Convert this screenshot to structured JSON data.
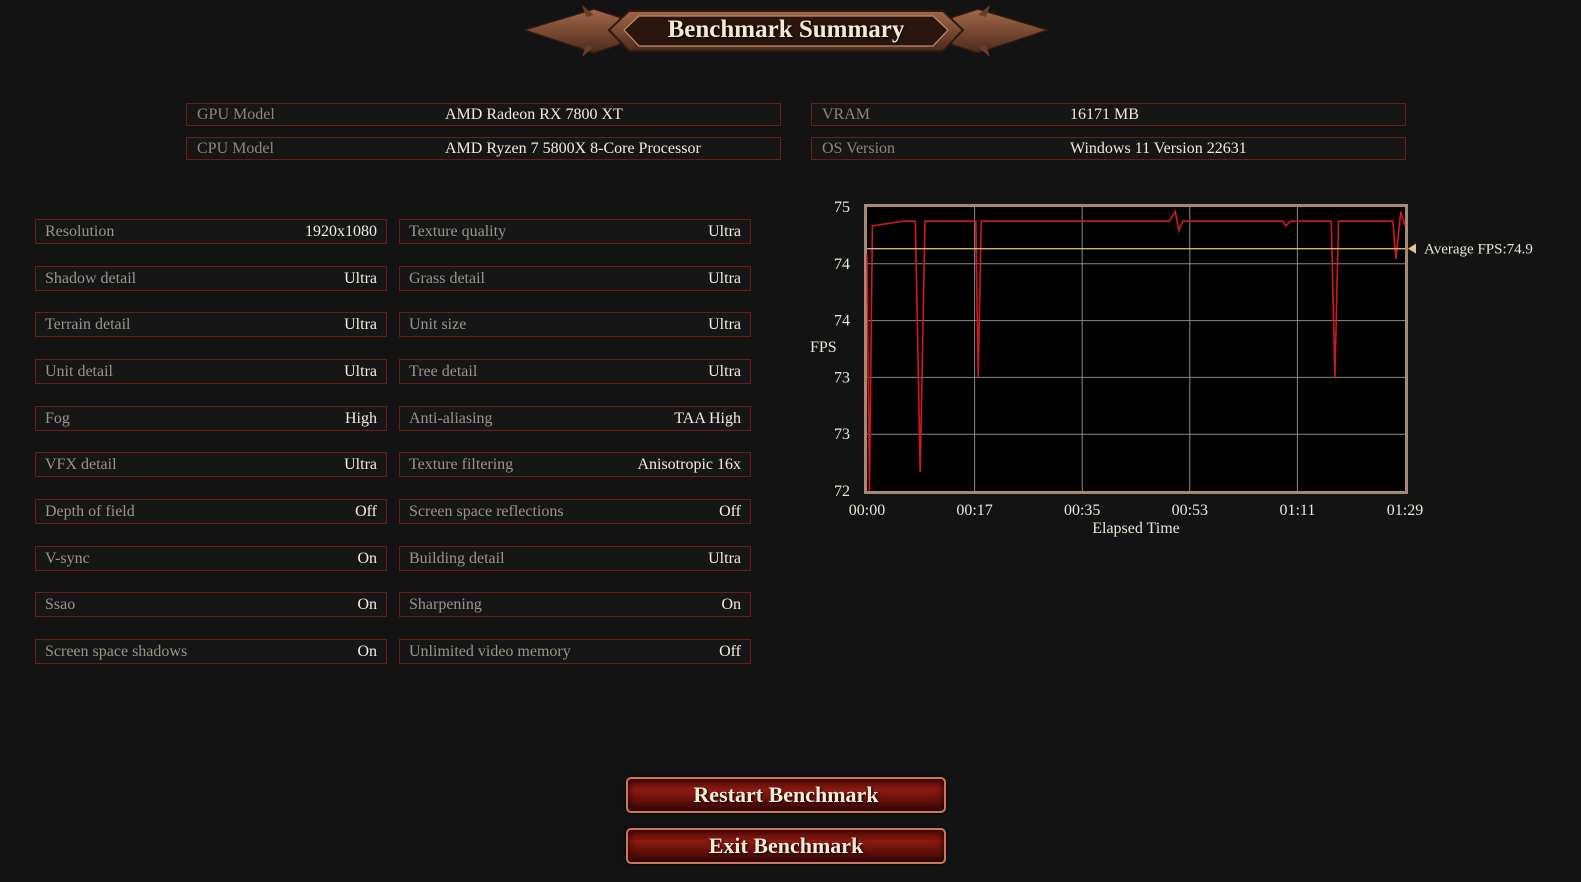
{
  "header": {
    "title": "Benchmark Summary"
  },
  "system_info": [
    {
      "label": "GPU Model",
      "value": "AMD Radeon RX 7800 XT"
    },
    {
      "label": "CPU Model",
      "value": "AMD Ryzen 7 5800X 8-Core Processor"
    },
    {
      "label": "VRAM",
      "value": "16171 MB"
    },
    {
      "label": "OS Version",
      "value": "Windows 11 Version 22631"
    }
  ],
  "settings": [
    {
      "label": "Resolution",
      "value": "1920x1080"
    },
    {
      "label": "Texture quality",
      "value": "Ultra"
    },
    {
      "label": "Shadow detail",
      "value": "Ultra"
    },
    {
      "label": "Grass detail",
      "value": "Ultra"
    },
    {
      "label": "Terrain detail",
      "value": "Ultra"
    },
    {
      "label": "Unit size",
      "value": "Ultra"
    },
    {
      "label": "Unit detail",
      "value": "Ultra"
    },
    {
      "label": "Tree detail",
      "value": "Ultra"
    },
    {
      "label": "Fog",
      "value": "High"
    },
    {
      "label": "Anti-aliasing",
      "value": "TAA High"
    },
    {
      "label": "VFX detail",
      "value": "Ultra"
    },
    {
      "label": "Texture filtering",
      "value": "Anisotropic 16x"
    },
    {
      "label": "Depth of field",
      "value": "Off"
    },
    {
      "label": "Screen space reflections",
      "value": "Off"
    },
    {
      "label": "V-sync",
      "value": "On"
    },
    {
      "label": "Building detail",
      "value": "Ultra"
    },
    {
      "label": "Ssao",
      "value": "On"
    },
    {
      "label": "Sharpening",
      "value": "On"
    },
    {
      "label": "Screen space shadows",
      "value": "On"
    },
    {
      "label": "Unlimited video memory",
      "value": "Off"
    }
  ],
  "chart_data": {
    "type": "line",
    "xlabel": "Elapsed Time",
    "ylabel": "FPS",
    "x_tick_labels": [
      "00:00",
      "00:17",
      "00:35",
      "00:53",
      "01:11",
      "01:29"
    ],
    "y_tick_labels": [
      "75",
      "74",
      "74",
      "73",
      "73",
      "72"
    ],
    "xlim": [
      0,
      89
    ],
    "ylim": [
      72,
      75
    ],
    "grid": true,
    "average": {
      "label": "Average FPS:74.9",
      "value": 74.56
    },
    "series": [
      {
        "color": "#d0191c",
        "points": [
          [
            0,
            74.5
          ],
          [
            0.4,
            72.0
          ],
          [
            0.9,
            74.8
          ],
          [
            6.0,
            74.85
          ],
          [
            8.0,
            74.85
          ],
          [
            8.8,
            72.2
          ],
          [
            9.6,
            74.85
          ],
          [
            18.0,
            74.85
          ],
          [
            18.4,
            73.2
          ],
          [
            18.9,
            74.85
          ],
          [
            50.0,
            74.85
          ],
          [
            51.0,
            74.95
          ],
          [
            51.6,
            74.75
          ],
          [
            52.2,
            74.85
          ],
          [
            68.8,
            74.85
          ],
          [
            69.3,
            74.8
          ],
          [
            70.0,
            74.85
          ],
          [
            76.8,
            74.85
          ],
          [
            77.4,
            73.2
          ],
          [
            78.0,
            74.85
          ],
          [
            87.0,
            74.85
          ],
          [
            87.5,
            74.45
          ],
          [
            88.3,
            74.95
          ],
          [
            89.0,
            74.8
          ]
        ]
      }
    ]
  },
  "colors": {
    "border_red": "#6e1a16",
    "line_red": "#d0191c",
    "avg_line": "#e0b060",
    "button_red": "#8c1a12"
  },
  "buttons": {
    "restart": "Restart Benchmark",
    "exit": "Exit Benchmark"
  }
}
